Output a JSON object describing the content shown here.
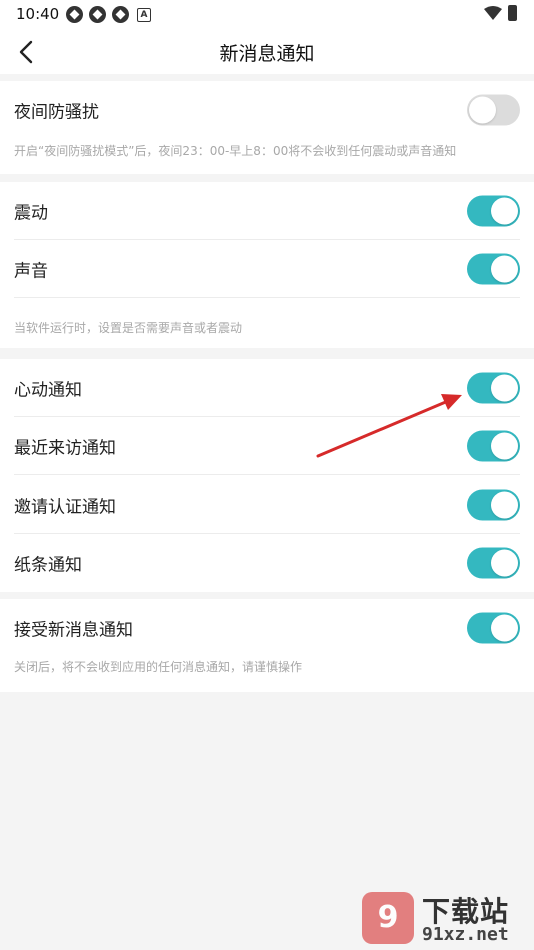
{
  "status_bar": {
    "time": "10:40",
    "notification_icons": [
      "app-notification-icon",
      "app-notification-icon",
      "app-notification-icon",
      "a-notification-icon"
    ],
    "a_icon_letter": "A",
    "wifi_icon": "wifi-icon",
    "battery_icon": "battery-icon"
  },
  "app_bar": {
    "back_icon": "back-arrow-icon",
    "title": "新消息通知"
  },
  "colors": {
    "toggle_on": "#34b8c0",
    "toggle_off": "#dcdcdc",
    "annotation_arrow": "#d62a2a"
  },
  "sections": {
    "night": {
      "row_label": "夜间防骚扰",
      "enabled": false,
      "note": "开启“夜间防骚扰模式”后，夜间23：00-早上8：00将不会收到任何震动或声音通知"
    },
    "feedback": {
      "vibrate_label": "震动",
      "vibrate_enabled": true,
      "sound_label": "声音",
      "sound_enabled": true,
      "note": "当软件运行时，设置是否需要声音或者震动"
    },
    "types": {
      "heartbeat_label": "心动通知",
      "heartbeat_enabled": true,
      "recent_visit_label": "最近来访通知",
      "recent_visit_enabled": true,
      "invite_verify_label": "邀请认证通知",
      "invite_verify_enabled": true,
      "note_paper_label": "纸条通知",
      "note_paper_enabled": true
    },
    "receive": {
      "row_label": "接受新消息通知",
      "enabled": true,
      "note": "关闭后，将不会收到应用的任何消息通知，请谨慎操作"
    }
  },
  "watermark": {
    "logo_text": "9",
    "brand_text": "下载站",
    "url_text": "91xz.net"
  }
}
